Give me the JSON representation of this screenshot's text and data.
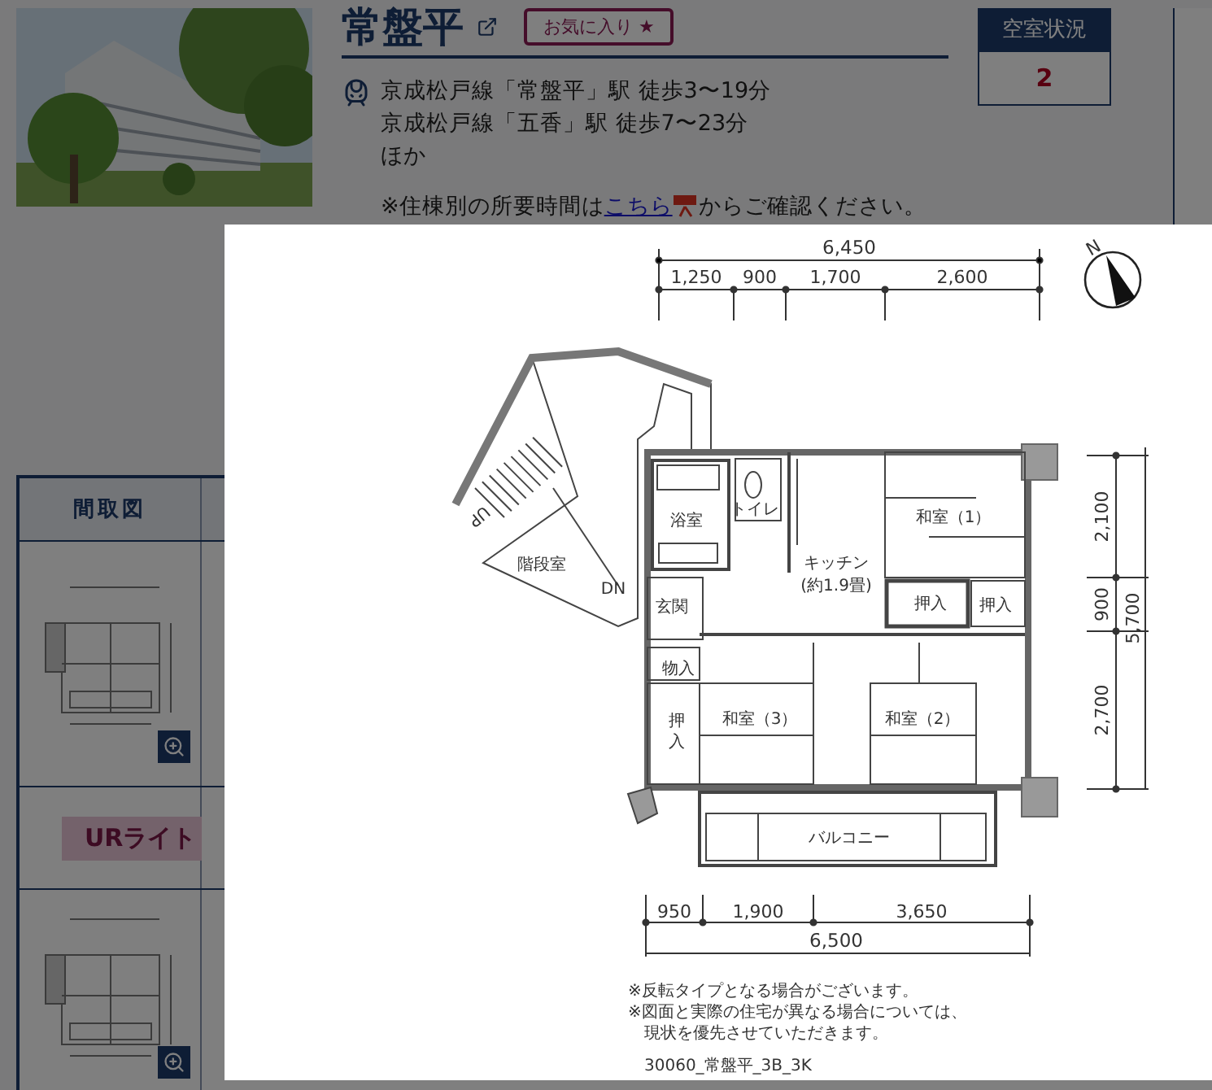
{
  "property": {
    "name": "常盤平",
    "favorite": "お気に入り ★"
  },
  "vacancy": {
    "label": "空室状況",
    "count": "2"
  },
  "access": {
    "lines": [
      "京成松戸線「常盤平」駅 徒歩3〜19分",
      "京成松戸線「五香」駅 徒歩7〜23分",
      "ほか"
    ],
    "note_before": "※住棟別の所要時間は",
    "note_link": "こちら",
    "note_after": "からご確認ください。"
  },
  "plans_table": {
    "header": "間取図",
    "rows": [
      {
        "kind": "plan"
      },
      {
        "kind": "badge",
        "badge": "URライト"
      },
      {
        "kind": "plan"
      }
    ]
  },
  "floorplan_popup": {
    "compass": "N",
    "top_dims": {
      "total": "6,450",
      "parts": [
        "1,250",
        "900",
        "1,700",
        "2,600"
      ]
    },
    "side_dims": {
      "total": "5,700",
      "parts": [
        "2,100",
        "900",
        "2,700"
      ]
    },
    "bottom_dims": {
      "total": "6,500",
      "parts": [
        "950",
        "1,900",
        "3,650"
      ]
    },
    "rooms": [
      {
        "label": "階段室"
      },
      {
        "label": "UP"
      },
      {
        "label": "DN"
      },
      {
        "label": "浴室"
      },
      {
        "label": "トイレ"
      },
      {
        "label": "玄関"
      },
      {
        "label": "キッチン"
      },
      {
        "label": "(約1.9畳)"
      },
      {
        "label": "和室（1）"
      },
      {
        "label": "押入"
      },
      {
        "label": "押入"
      },
      {
        "label": "物入"
      },
      {
        "label": "押入"
      },
      {
        "label": "和室（3）"
      },
      {
        "label": "和室（2）"
      },
      {
        "label": "バルコニー"
      }
    ],
    "notes": [
      "※反転タイプとなる場合がございます。",
      "※図面と実際の住宅が異なる場合については、",
      "　現状を優先させていただきます。"
    ],
    "code": "30060_常盤平_3B_3K"
  }
}
